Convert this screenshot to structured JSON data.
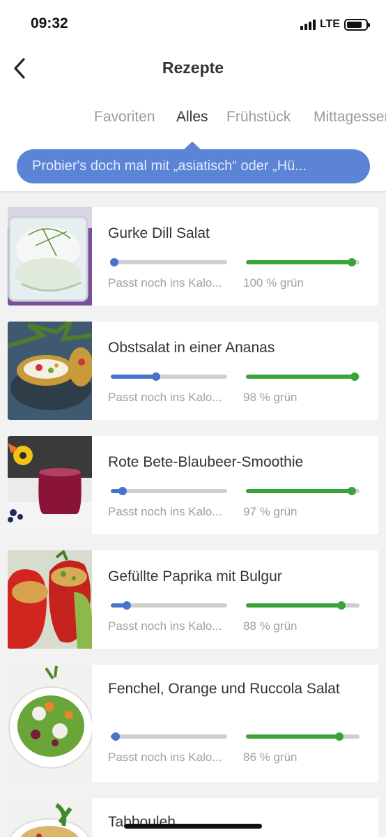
{
  "status": {
    "time": "09:32",
    "network": "LTE"
  },
  "header": {
    "title": "Rezepte",
    "back_icon": "chevron-left-icon"
  },
  "tabs": [
    {
      "label": "Favoriten",
      "active": false
    },
    {
      "label": "Alles",
      "active": true
    },
    {
      "label": "Frühstück",
      "active": false
    },
    {
      "label": "Mittagessen",
      "active": false
    }
  ],
  "tip": {
    "text": "Probier's doch mal mit „asiatisch“ oder „Hü..."
  },
  "colors": {
    "accent_blue": "#4a74cc",
    "accent_green": "#3aa43a",
    "tip_bg": "#5b84d6"
  },
  "recipes": [
    {
      "name": "Gurke Dill Salat",
      "calorie_text": "Passt noch ins Kalo...",
      "calorie_level": 0.03,
      "green_text": "100 % grün",
      "green_level": 0.93
    },
    {
      "name": "Obstsalat in einer Ananas",
      "calorie_text": "Passt noch ins Kalo...",
      "calorie_level": 0.39,
      "green_text": "98 % grün",
      "green_level": 0.96
    },
    {
      "name": "Rote Bete-Blaubeer-Smoothie",
      "calorie_text": "Passt noch ins Kalo...",
      "calorie_level": 0.1,
      "green_text": "97 % grün",
      "green_level": 0.93
    },
    {
      "name": "Gefüllte Paprika mit Bulgur",
      "calorie_text": "Passt noch ins Kalo...",
      "calorie_level": 0.14,
      "green_text": "88 % grün",
      "green_level": 0.84
    },
    {
      "name": "Fenchel, Orange und Ruccola Salat",
      "calorie_text": "Passt noch ins Kalo...",
      "calorie_level": 0.04,
      "green_text": "86 % grün",
      "green_level": 0.82
    },
    {
      "name": "Tabbouleh"
    }
  ]
}
